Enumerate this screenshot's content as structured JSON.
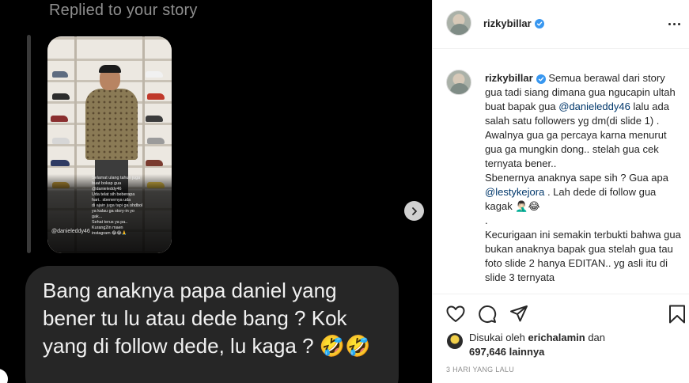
{
  "media": {
    "replied_label": "Replied to your story",
    "story": {
      "overlay_text": "Selamat ulang tahun juga\nbuat bokap gua\n@danieleddy46\nUda telat sih beberapa\nhari.. sbenernya uda\ndi ajain juga tapi ga ohdbol\nya kalau ga story-in yo\ngak...\nSehat terus ya pa..\nKurang2in maen\ninstagram 😂😂🙏",
      "handle": "@danieleddy46"
    },
    "reply_message": "Bang anaknya papa daniel yang bener tu lu atau dede bang ? Kok yang di follow dede, lu kaga ? 🤣🤣",
    "next_icon": "chevron-right-icon"
  },
  "post": {
    "username": "rizkybillar",
    "verified": true,
    "more_icon": "more-horizontal-icon",
    "caption": {
      "username": "rizkybillar",
      "p1_before": " Semua berawal dari story gua tadi siang dimana gua ngucapin ultah buat bapak gua ",
      "p1_mention": "@danieleddy46",
      "p1_after": " lalu ada salah satu followers yg dm(di slide 1) .",
      "p2": "Awalnya gua ga percaya karna menurut gua ga mungkin dong.. stelah gua cek ternyata bener..",
      "p3_before": "Sbenernya anaknya sape sih ? Gua apa ",
      "p3_mention": "@lestykejora",
      "p3_after": " . Lah dede di follow gua kagak 🤦🏻‍♂️😂",
      "p4": ".",
      "p5": "Kecurigaan ini semakin terbukti bahwa gua bukan anaknya bapak gua stelah gua tau foto slide 2 hanya EDITAN.. yg asli itu di slide 3 ternyata"
    },
    "actions": {
      "like_icon": "heart-icon",
      "comment_icon": "comment-icon",
      "share_icon": "send-icon",
      "save_icon": "bookmark-icon"
    },
    "likes": {
      "prefix": "Disukai oleh ",
      "user": "erichalamin",
      "middle": " dan",
      "count": "697,646 lainnya"
    },
    "time_ago": "3 HARI YANG LALU"
  },
  "colors": {
    "media_bg": "#000000",
    "bubble_bg": "#262626",
    "verified": "#3897f0",
    "mention": "#00376b",
    "muted": "#8e8e8e"
  }
}
